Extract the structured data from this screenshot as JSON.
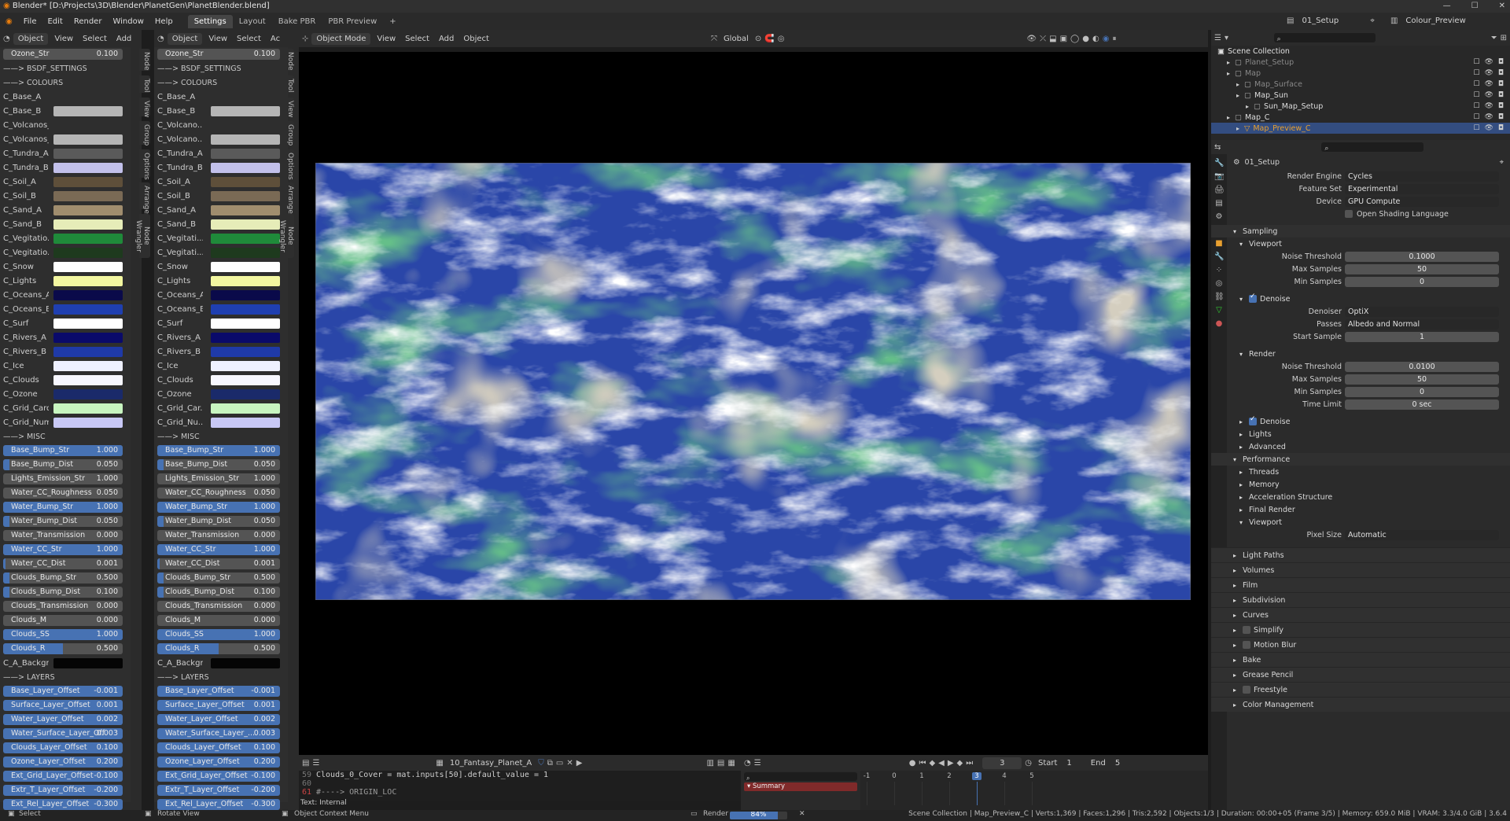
{
  "app": {
    "title": "Blender* [D:\\Projects\\3D\\Blender\\PlanetGen\\PlanetBlender.blend]"
  },
  "menu": {
    "items": [
      "File",
      "Edit",
      "Render",
      "Window",
      "Help"
    ],
    "workspaces": [
      "Settings",
      "Layout",
      "Bake PBR",
      "PBR Preview"
    ],
    "add_ws": "+",
    "scene": "01_Setup",
    "view_layer": "Colour_Preview"
  },
  "node_panel": {
    "header": {
      "object": "Object",
      "view": "View",
      "select": "Select",
      "add": "Add"
    },
    "header2": {
      "object": "Object",
      "view": "View",
      "select": "Select",
      "add": "Ac"
    },
    "top": {
      "label": "Ozone_Str",
      "value": "0.100"
    },
    "sections": {
      "bsdf": "——> BSDF_SETTINGS",
      "colours": "——> COLOURS",
      "misc": "——> MISC",
      "layers": "——> LAYERS"
    },
    "colours_a": [
      {
        "l": "C_Base_A",
        "c": ""
      },
      {
        "l": "C_Base_B",
        "c": "#b5b5b5"
      },
      {
        "l": "C_Volcanos_A",
        "c": ""
      },
      {
        "l": "C_Volcanos_B",
        "c": "#b5b5b5"
      },
      {
        "l": "C_Tundra_A",
        "c": "#5a5a5a"
      },
      {
        "l": "C_Tundra_B",
        "c": "#c2c0ea"
      },
      {
        "l": "C_Soil_A",
        "c": "#5e4f3a"
      },
      {
        "l": "C_Soil_B",
        "c": "#7a6a55"
      },
      {
        "l": "C_Sand_A",
        "c": "#a08d6e"
      },
      {
        "l": "C_Sand_B",
        "c": "#e6ecb8"
      },
      {
        "l": "C_Vegitatio...",
        "c": "#1f8a3a"
      },
      {
        "l": "C_Vegitatio...",
        "c": "#1e3a1e"
      },
      {
        "l": "C_Snow",
        "c": "#ffffff"
      },
      {
        "l": "C_Lights",
        "c": "#f3f7a0"
      },
      {
        "l": "C_Oceans_A",
        "c": "#0a0a4a"
      },
      {
        "l": "C_Oceans_B",
        "c": "#1f3fb0"
      },
      {
        "l": "C_Surf",
        "c": "#ffffff"
      },
      {
        "l": "C_Rivers_A",
        "c": "#0a0a6a"
      },
      {
        "l": "C_Rivers_B",
        "c": "#1f3aa8"
      },
      {
        "l": "C_Ice",
        "c": "#eef0ff"
      },
      {
        "l": "C_Clouds",
        "c": "#f7f7ff"
      },
      {
        "l": "C_Ozone",
        "c": "#1a2a6a"
      },
      {
        "l": "C_Grid_Card...",
        "c": "#c8f5c0"
      },
      {
        "l": "C_Grid_Num...",
        "c": "#c8c8f5"
      }
    ],
    "colours_b": [
      {
        "l": "C_Base_A",
        "c": ""
      },
      {
        "l": "C_Base_B",
        "c": "#b5b5b5"
      },
      {
        "l": "C_Volcano...",
        "c": ""
      },
      {
        "l": "C_Volcano...",
        "c": "#b5b5b5"
      },
      {
        "l": "C_Tundra_A",
        "c": "#5a5a5a"
      },
      {
        "l": "C_Tundra_B",
        "c": "#c2c0ea"
      },
      {
        "l": "C_Soil_A",
        "c": "#5e4f3a"
      },
      {
        "l": "C_Soil_B",
        "c": "#7a6a55"
      },
      {
        "l": "C_Sand_A",
        "c": "#a08d6e"
      },
      {
        "l": "C_Sand_B",
        "c": "#e6ecb8"
      },
      {
        "l": "C_Vegitati...",
        "c": "#1f8a3a"
      },
      {
        "l": "C_Vegitati...",
        "c": "#1e3a1e"
      },
      {
        "l": "C_Snow",
        "c": "#ffffff"
      },
      {
        "l": "C_Lights",
        "c": "#f3f7a0"
      },
      {
        "l": "C_Oceans_A",
        "c": "#0a0a4a"
      },
      {
        "l": "C_Oceans_B",
        "c": "#1f3fb0"
      },
      {
        "l": "C_Surf",
        "c": "#ffffff"
      },
      {
        "l": "C_Rivers_A",
        "c": "#0a0a6a"
      },
      {
        "l": "C_Rivers_B",
        "c": "#1f3aa8"
      },
      {
        "l": "C_Ice",
        "c": "#eef0ff"
      },
      {
        "l": "C_Clouds",
        "c": "#f7f7ff"
      },
      {
        "l": "C_Ozone",
        "c": "#1a2a6a"
      },
      {
        "l": "C_Grid_Car...",
        "c": "#c8f5c0"
      },
      {
        "l": "C_Grid_Nu...",
        "c": "#c8c8f5"
      }
    ],
    "misc": [
      {
        "l": "Base_Bump_Str",
        "v": "1.000",
        "f": 1.0
      },
      {
        "l": "Base_Bump_Dist",
        "v": "0.050",
        "f": 0.05
      },
      {
        "l": "Lights_Emission_Str",
        "v": "1.000",
        "f": 0.0
      },
      {
        "l": "Water_CC_Roughness",
        "v": "0.050",
        "f": 0.0
      },
      {
        "l": "Water_Bump_Str",
        "v": "1.000",
        "f": 1.0
      },
      {
        "l": "Water_Bump_Dist",
        "v": "0.050",
        "f": 0.05
      },
      {
        "l": "Water_Transmission",
        "v": "0.000",
        "f": 0.0
      },
      {
        "l": "Water_CC_Str",
        "v": "1.000",
        "f": 1.0
      },
      {
        "l": "Water_CC_Dist",
        "v": "0.001",
        "f": 0.02
      },
      {
        "l": "Clouds_Bump_Str",
        "v": "0.500",
        "f": 0.05
      },
      {
        "l": "Clouds_Bump_Dist",
        "v": "0.100",
        "f": 0.05
      },
      {
        "l": "Clouds_Transmission",
        "v": "0.000",
        "f": 0.0
      },
      {
        "l": "Clouds_M",
        "v": "0.000",
        "f": 0.0
      },
      {
        "l": "Clouds_SS",
        "v": "1.000",
        "f": 1.0
      },
      {
        "l": "Clouds_R",
        "v": "0.500",
        "f": 0.5
      }
    ],
    "misc_bg": {
      "l": "C_A_Backgr...",
      "c": "#050505"
    },
    "layers": [
      {
        "l": "Base_Layer_Offset",
        "v": "-0.001"
      },
      {
        "l": "Surface_Layer_Offset",
        "v": "0.001"
      },
      {
        "l": "Water_Layer_Offset",
        "v": "0.002"
      },
      {
        "l": "Water_Surface_Layer_Off",
        "v": "0.003"
      },
      {
        "l": "Clouds_Layer_Offset",
        "v": "0.100"
      },
      {
        "l": "Ozone_Layer_Offset",
        "v": "0.200"
      },
      {
        "l": "Ext_Grid_Layer_Offset",
        "v": "-0.100"
      },
      {
        "l": "Extr_T_Layer_Offset",
        "v": "-0.200"
      },
      {
        "l": "Ext_Rel_Layer_Offset",
        "v": "-0.300"
      }
    ],
    "layers_b": [
      {
        "l": "Base_Layer_Offset",
        "v": "-0.001"
      },
      {
        "l": "Surface_Layer_Offset",
        "v": "0.001"
      },
      {
        "l": "Water_Layer_Offset",
        "v": "0.002"
      },
      {
        "l": "Water_Surface_Layer_...",
        "v": "0.003"
      },
      {
        "l": "Clouds_Layer_Offset",
        "v": "0.100"
      },
      {
        "l": "Ozone_Layer_Offset",
        "v": "0.200"
      },
      {
        "l": "Ext_Grid_Layer_Offset",
        "v": "-0.100"
      },
      {
        "l": "Extr_T_Layer_Offset",
        "v": "-0.200"
      },
      {
        "l": "Ext_Rel_Layer_Offset",
        "v": "-0.300"
      }
    ],
    "vtabs": [
      "Node",
      "Tool",
      "View",
      "Group",
      "Options",
      "Arrange",
      "Node Wrangler"
    ]
  },
  "viewport": {
    "mode": "Object Mode",
    "view": "View",
    "select": "Select",
    "add": "Add",
    "object": "Object",
    "transform": "Global"
  },
  "text_editor": {
    "file": "10_Fantasy_Planet_A",
    "lines": [
      {
        "n": "59",
        "t": "Clouds_0_Cover = mat.inputs[50].default_value = 1"
      },
      {
        "n": "60",
        "t": ""
      },
      {
        "n": "61",
        "t": "#----> ORIGIN_LOC"
      }
    ],
    "status": "Text: Internal"
  },
  "timeline": {
    "frame": "3",
    "start_label": "Start",
    "start": "1",
    "end_label": "End",
    "end": "5",
    "ticks": [
      "-1",
      "0",
      "1",
      "2",
      "3",
      "4",
      "5"
    ],
    "summary": "Summary"
  },
  "outliner": {
    "root": "Scene Collection",
    "items": [
      {
        "n": "Planet_Setup",
        "d": 0
      },
      {
        "n": "Map",
        "d": 0
      },
      {
        "n": "Map_Surface",
        "d": 1
      },
      {
        "n": "Map_Sun",
        "d": 1
      },
      {
        "n": "Sun_Map_Setup",
        "d": 2
      },
      {
        "n": "Map_C",
        "d": 0
      },
      {
        "n": "Map_Preview_C",
        "d": 1
      }
    ]
  },
  "properties": {
    "scene": "01_Setup",
    "render_engine": {
      "label": "Render Engine",
      "value": "Cycles"
    },
    "feature_set": {
      "label": "Feature Set",
      "value": "Experimental"
    },
    "device": {
      "label": "Device",
      "value": "GPU Compute"
    },
    "osl": "Open Shading Language",
    "sampling": "Sampling",
    "viewport": "Viewport",
    "noise_threshold": "Noise Threshold",
    "vp_noise": "0.1000",
    "max_samples": "Max Samples",
    "vp_max": "50",
    "min_samples": "Min Samples",
    "vp_min": "0",
    "denoise": "Denoise",
    "denoiser": "Denoiser",
    "denoiser_v": "OptiX",
    "passes": "Passes",
    "passes_v": "Albedo and Normal",
    "start_sample": "Start Sample",
    "start_sample_v": "1",
    "render": "Render",
    "r_noise": "0.0100",
    "r_max": "50",
    "r_min": "0",
    "time_limit": "Time Limit",
    "time_limit_v": "0 sec",
    "lights": "Lights",
    "advanced": "Advanced",
    "performance": "Performance",
    "threads": "Threads",
    "memory": "Memory",
    "accel": "Acceleration Structure",
    "final": "Final Render",
    "perf_vp": "Viewport",
    "pixel_size": "Pixel Size",
    "pixel_size_v": "Automatic",
    "panels": [
      "Light Paths",
      "Volumes",
      "Film",
      "Subdivision",
      "Curves",
      "Simplify",
      "Motion Blur",
      "Bake",
      "Grease Pencil",
      "Freestyle",
      "Color Management"
    ]
  },
  "statusbar": {
    "select": "Select",
    "rotate": "Rotate View",
    "context": "Object Context Menu",
    "render": "Render",
    "progress": "84%",
    "progress_value": 0.84,
    "info": "Scene Collection | Map_Preview_C | Verts:1,369 | Faces:1,296 | Tris:2,592 | Objects:1/3 | Duration: 00:00+05 (Frame 3/5) | Memory: 659.0 MiB | VRAM: 3.3/4.0 GiB | 3.6.4"
  },
  "colors": {
    "accent": "#4772b3",
    "bg": "#1d1d1d",
    "panel": "#2b2b2b"
  }
}
